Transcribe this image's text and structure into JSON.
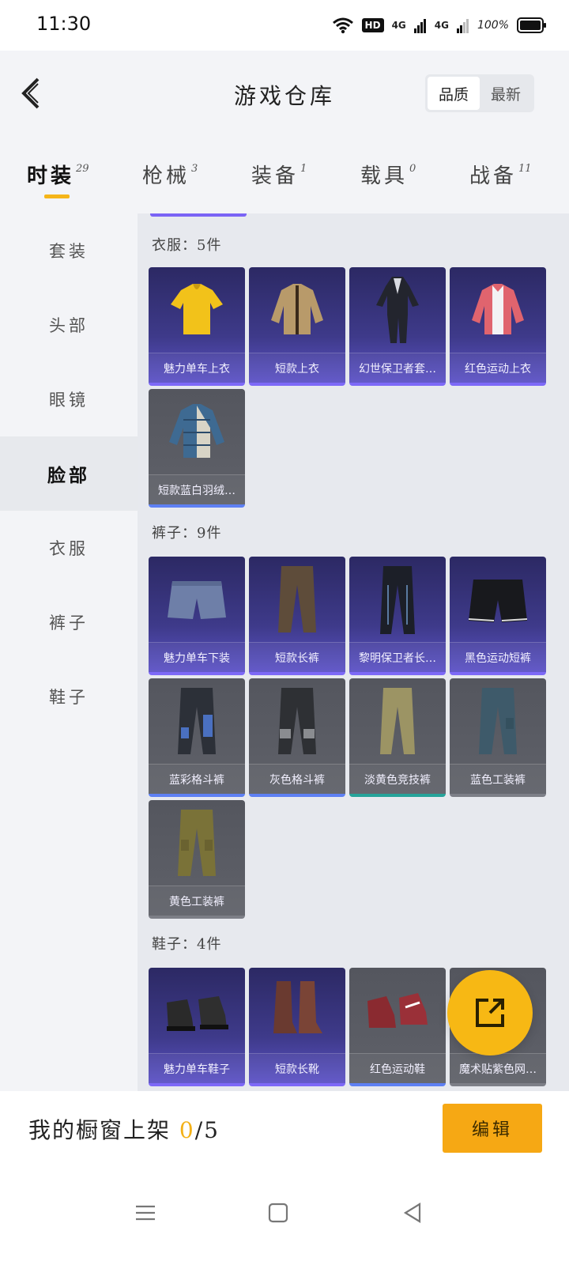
{
  "status_bar": {
    "time": "11:30",
    "hd_badge": "HD",
    "signal_1": "4G",
    "signal_2": "4G",
    "battery": "100%"
  },
  "header": {
    "title": "游戏仓库",
    "sort_options": [
      "品质",
      "最新"
    ],
    "active_sort": "品质"
  },
  "category_tabs": [
    {
      "label": "时装",
      "count": "29",
      "active": true
    },
    {
      "label": "枪械",
      "count": "3",
      "active": false
    },
    {
      "label": "装备",
      "count": "1",
      "active": false
    },
    {
      "label": "载具",
      "count": "0",
      "active": false
    },
    {
      "label": "战备",
      "count": "11",
      "active": false
    }
  ],
  "sidebar": {
    "items": [
      {
        "label": "套装"
      },
      {
        "label": "头部"
      },
      {
        "label": "眼镜"
      },
      {
        "label": "脸部",
        "active": true
      },
      {
        "label": "衣服"
      },
      {
        "label": "裤子"
      },
      {
        "label": "鞋子"
      }
    ]
  },
  "sections": [
    {
      "title": "衣服：5件",
      "items": [
        {
          "name": "魅力单车上衣",
          "rarity": "purple",
          "icon": "yellow-shirt"
        },
        {
          "name": "短款上衣",
          "rarity": "purple",
          "icon": "tan-jacket"
        },
        {
          "name": "幻世保卫者套…",
          "rarity": "purple",
          "icon": "dark-suit"
        },
        {
          "name": "红色运动上衣",
          "rarity": "purple",
          "icon": "red-jacket"
        },
        {
          "name": "短款蓝白羽绒…",
          "rarity": "gray-blue",
          "icon": "blue-down-jacket"
        }
      ]
    },
    {
      "title": "裤子：9件",
      "items": [
        {
          "name": "魅力单车下装",
          "rarity": "purple",
          "icon": "denim-shorts"
        },
        {
          "name": "短款长裤",
          "rarity": "purple",
          "icon": "brown-pants"
        },
        {
          "name": "黎明保卫者长…",
          "rarity": "purple",
          "icon": "black-pants"
        },
        {
          "name": "黑色运动短裤",
          "rarity": "purple",
          "icon": "black-shorts"
        },
        {
          "name": "蓝彩格斗裤",
          "rarity": "gray-blue",
          "icon": "blue-combat-pants"
        },
        {
          "name": "灰色格斗裤",
          "rarity": "gray-blue",
          "icon": "gray-combat-pants"
        },
        {
          "name": "淡黄色竞技裤",
          "rarity": "gray-teal",
          "icon": "khaki-pants"
        },
        {
          "name": "蓝色工装裤",
          "rarity": "gray",
          "icon": "blue-cargo-pants"
        },
        {
          "name": "黄色工装裤",
          "rarity": "gray",
          "icon": "yellow-cargo-pants"
        }
      ]
    },
    {
      "title": "鞋子：4件",
      "items": [
        {
          "name": "魅力单车鞋子",
          "rarity": "purple",
          "icon": "black-boots"
        },
        {
          "name": "短款长靴",
          "rarity": "purple",
          "icon": "brown-boots"
        },
        {
          "name": "红色运动鞋",
          "rarity": "gray-blue",
          "icon": "red-sneakers"
        },
        {
          "name": "魔术贴紫色网…",
          "rarity": "gray",
          "icon": "purple-mesh-shoes"
        }
      ]
    }
  ],
  "bottom_bar": {
    "label": "我的橱窗上架",
    "current": "0",
    "max": "/5",
    "edit_label": "编辑"
  },
  "colors": {
    "accent": "#f6a814",
    "purple_rarity": "#7d69f7",
    "blue_rarity": "#5e80f3",
    "teal_rarity": "#26a49a"
  }
}
